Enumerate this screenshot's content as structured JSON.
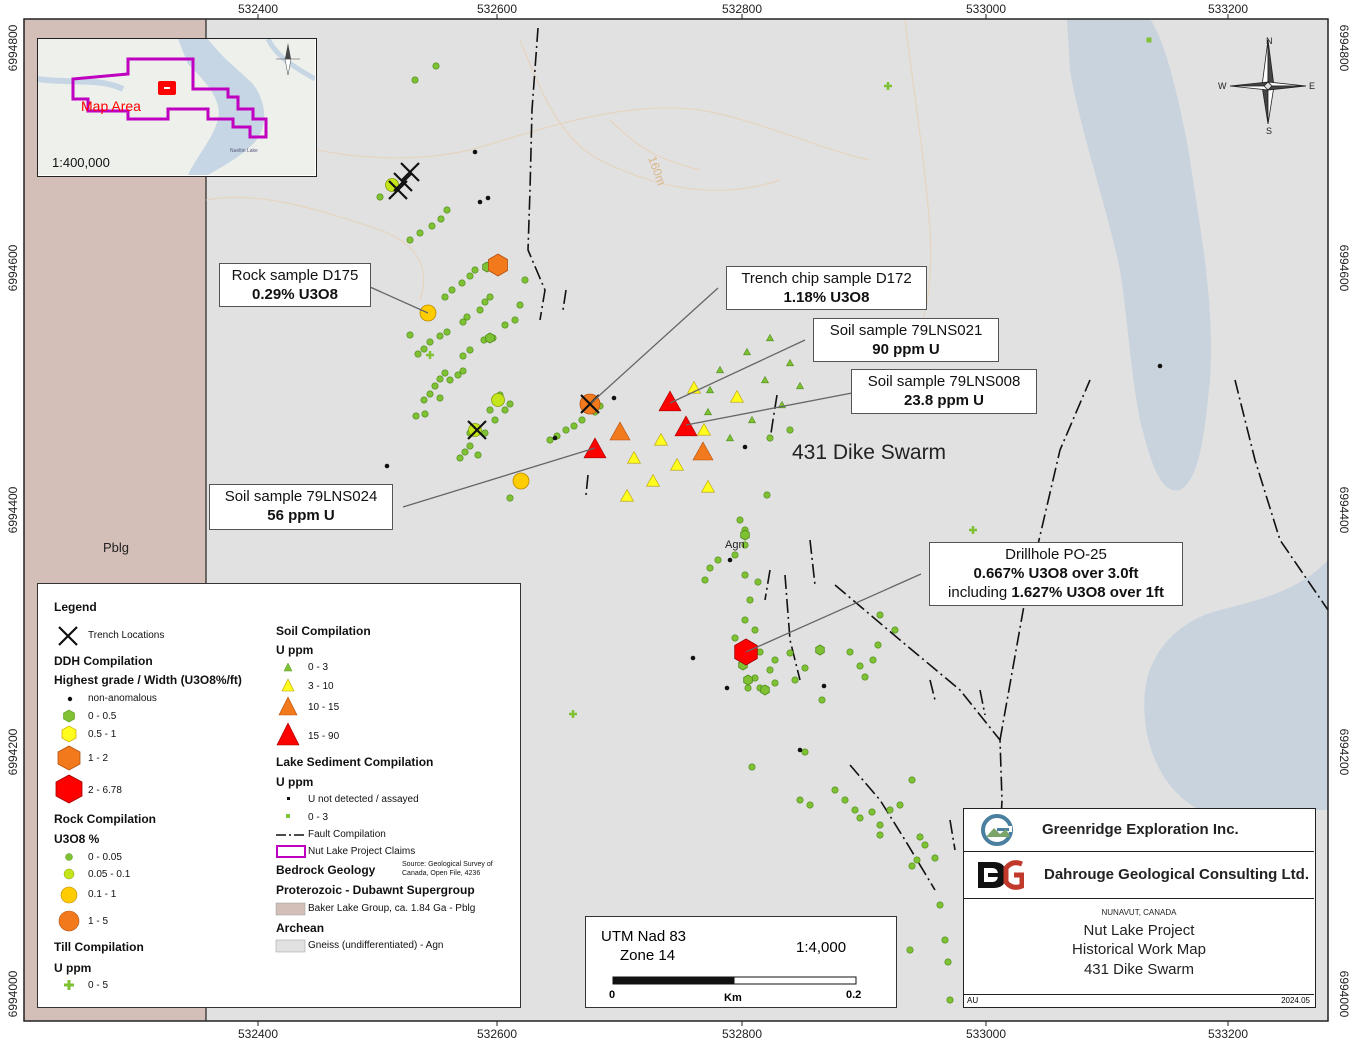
{
  "frame": {
    "top_ticks": [
      "532400",
      "532600",
      "532800",
      "533000",
      "533200"
    ],
    "bottom_ticks": [
      "532400",
      "532600",
      "532800",
      "533000",
      "533200"
    ],
    "left_ticks": [
      "6994800",
      "6994600",
      "6994400",
      "6994200",
      "6994000"
    ],
    "right_ticks": [
      "6994800",
      "6994600",
      "6994400",
      "6994200",
      "6994000"
    ]
  },
  "map_labels": {
    "dike_swarm": "431 Dike Swarm",
    "pblg": "Pblg",
    "agn": "Agn",
    "contour": "160m"
  },
  "callouts": {
    "rock_d175": {
      "line1": "Rock sample D175",
      "line2": "0.29% U3O8"
    },
    "trench_d172": {
      "line1": "Trench chip sample D172",
      "line2": "1.18% U3O8"
    },
    "soil_021": {
      "line1": "Soil sample 79LNS021",
      "line2": "90 ppm U"
    },
    "soil_008": {
      "line1": "Soil sample 79LNS008",
      "line2": "23.8 ppm U"
    },
    "soil_024": {
      "line1": "Soil sample 79LNS024",
      "line2": "56 ppm U"
    },
    "drillhole": {
      "line1": "Drillhole PO-25",
      "line2": "0.667% U3O8 over 3.0ft",
      "line3_prefix": "including ",
      "line3": "1.627% U3O8 over 1ft"
    }
  },
  "inset": {
    "label": "Map Area",
    "scale": "1:400,000",
    "lake": "Nueltin Lake"
  },
  "north_arrow": {
    "n": "N",
    "s": "S",
    "e": "E",
    "w": "W"
  },
  "legend": {
    "title": "Legend",
    "trench": "Trench Locations",
    "ddh_title": "DDH Compilation",
    "ddh_sub": "Highest grade / Width (U3O8%/ft)",
    "ddh_items": [
      "non-anomalous",
      "0 - 0.5",
      "0.5 - 1",
      "1 - 2",
      "2 - 6.78"
    ],
    "rock_title": "Rock Compilation",
    "rock_sub": "U3O8 %",
    "rock_items": [
      "0 - 0.05",
      "0.05 - 0.1",
      "0.1 - 1",
      "1 - 5"
    ],
    "till_title": "Till Compilation",
    "till_sub": "U ppm",
    "till_items": [
      "0 - 5"
    ],
    "soil_title": "Soil Compilation",
    "soil_sub": "U ppm",
    "soil_items": [
      "0 - 3",
      "3 - 10",
      "10 - 15",
      "15 - 90"
    ],
    "lake_title": "Lake Sediment Compilation",
    "lake_sub": "U ppm",
    "lake_items": [
      "U not detected / assayed",
      "0 - 3"
    ],
    "fault": "Fault Compilation",
    "claims": "Nut Lake Project Claims",
    "bedrock": "Bedrock Geology",
    "source": "Source: Geological Survey of Canada, Open File, 4236",
    "proterozoic": "Proterozoic - Dubawnt Supergroup",
    "baker": "Baker Lake Group, ca. 1.84 Ga - Pblg",
    "archean": "Archean",
    "gneiss": "Gneiss (undifferentiated) - Agn"
  },
  "scale_box": {
    "datum": "UTM Nad 83",
    "zone": "Zone 14",
    "scale": "1:4,000",
    "zero": "0",
    "unit": "Km",
    "max": "0.2"
  },
  "title_block": {
    "company1": "Greenridge Exploration Inc.",
    "company2": "Dahrouge Geological Consulting Ltd.",
    "region": "NUNAVUT, CANADA",
    "project": "Nut Lake Project",
    "map_title": "Historical Work Map",
    "area": "431 Dike Swarm",
    "author": "AU",
    "date": "2024.05"
  },
  "colors": {
    "gneiss": "#e1e1e1",
    "baker": "#d3bfb7",
    "water": "#c9d3dd",
    "green_dot": "#7ec234",
    "yellow": "#fffc1e",
    "orange": "#f27a1c",
    "red": "#ff0000",
    "claims": "#c000c0"
  }
}
